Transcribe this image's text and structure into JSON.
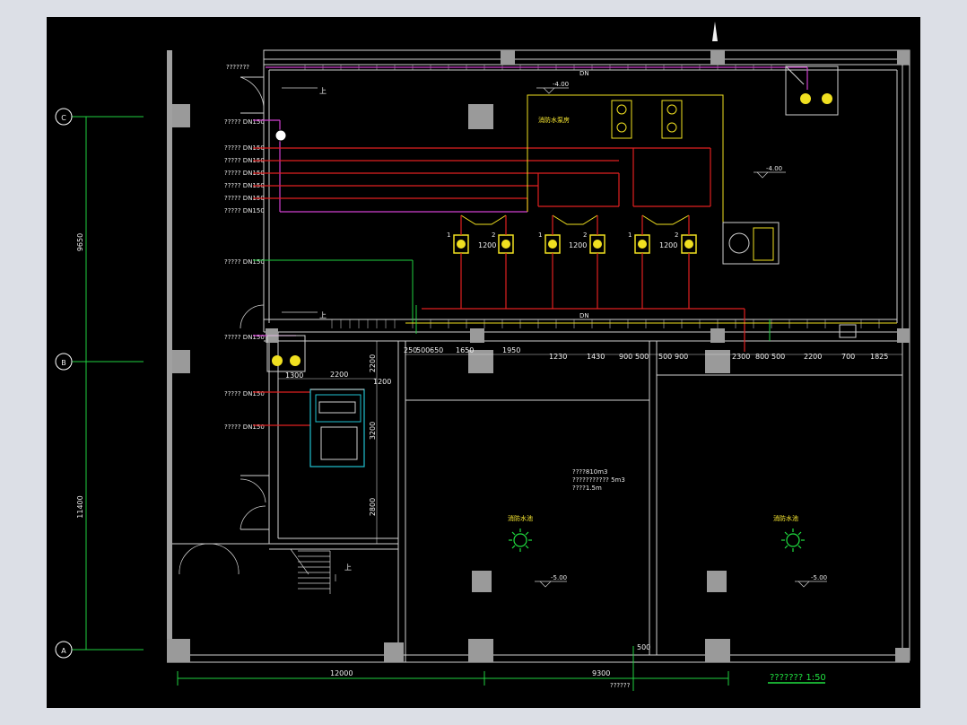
{
  "drawing": {
    "grid_axes": [
      "C",
      "B",
      "A"
    ],
    "vertical_dims": [
      "9650",
      "11400"
    ],
    "bottom_dims": [
      "12000",
      "9300"
    ],
    "scale_title": "???????  1:50",
    "pump_room_label": "消防水泵房",
    "pool_label_left": "消防水池",
    "pool_label_right": "消防水池",
    "pool_note_lines": [
      "????810m3",
      "??????????? 5m3",
      "????1.5m"
    ],
    "up_label": "上",
    "elev_labels": [
      "-4.00",
      "-4.00",
      "-5.00",
      "-5.00",
      "-4.00"
    ],
    "pipe_labels_left": [
      "????? DN150",
      "????? DN150",
      "????? DN150",
      "????? DN150",
      "????? DN150",
      "????? DN150",
      "????? DN150",
      "????? DN150"
    ],
    "pipe_label_top": "???????",
    "pump_dims": [
      "1200",
      "1200",
      "1200"
    ],
    "pump_numbers": [
      "1",
      "2",
      "1",
      "2",
      "1",
      "2"
    ],
    "horizontal_dims": [
      "250",
      "500",
      "650",
      "1650",
      "1950",
      "1230",
      "1430",
      "900",
      "500",
      "500",
      "900",
      "2300",
      "800",
      "500",
      "2200",
      "700",
      "1825"
    ],
    "tank_room_dims": [
      "2200",
      "1300",
      "1200",
      "3200",
      "2200",
      "2800"
    ],
    "bottom_dim_small": "500",
    "bottom_note": "??????",
    "side_marks": [
      "DN",
      "DN"
    ]
  }
}
